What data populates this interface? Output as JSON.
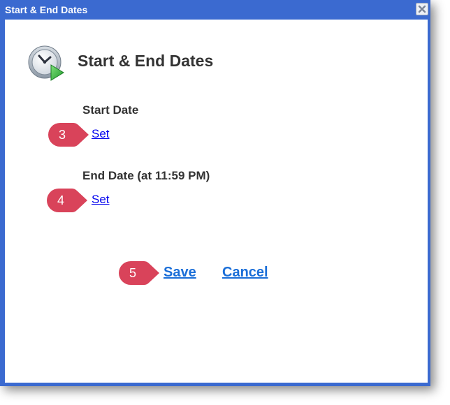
{
  "window": {
    "title": "Start & End Dates",
    "close_icon": "close-icon"
  },
  "header": {
    "icon": "clock-play-icon",
    "title": "Start & End Dates"
  },
  "start_date": {
    "label": "Start Date",
    "link": "Set"
  },
  "end_date": {
    "label": "End Date (at 11:59 PM)",
    "link": "Set"
  },
  "actions": {
    "save": "Save",
    "cancel": "Cancel"
  },
  "callouts": [
    {
      "number": "3"
    },
    {
      "number": "4"
    },
    {
      "number": "5"
    }
  ],
  "colors": {
    "titlebar": "#3b6ad0",
    "link": "#0000ee",
    "action_link": "#1a6ed8",
    "callout": "#d9435a",
    "text": "#333333"
  }
}
